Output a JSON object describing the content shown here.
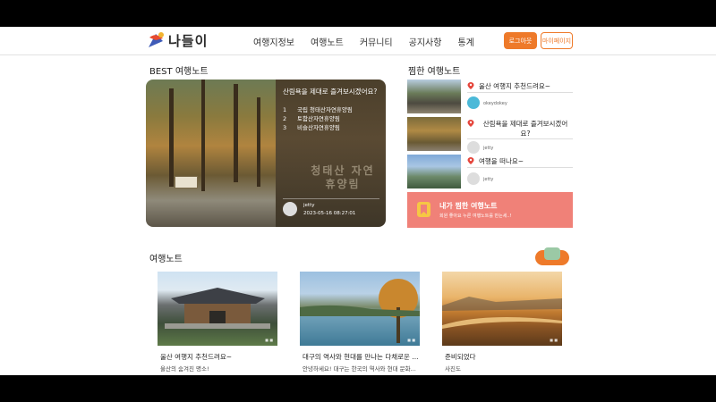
{
  "header": {
    "logo_text": "나들이",
    "nav": [
      "여행지정보",
      "여행노트",
      "커뮤니티",
      "공지사항",
      "통계"
    ],
    "login_label": "로그아웃",
    "mypage_label": "마이페이지"
  },
  "best": {
    "section_title": "BEST 여행노트",
    "title": "산림욕을 제대로 즐겨보시겠어요?",
    "list": [
      {
        "num": "1",
        "name": "국립 청태산자연휴양림"
      },
      {
        "num": "2",
        "name": "토함산자연휴양림"
      },
      {
        "num": "3",
        "name": "비슬산자연휴양림"
      }
    ],
    "photo_text": "청태산 자연휴양림",
    "user": "jetty",
    "date": "2023-05-16 08:27:01"
  },
  "bookmarks": {
    "section_title": "찜한 여행노트",
    "items": [
      {
        "title": "울산 여행지 추천드려요~",
        "user": "okeydokey"
      },
      {
        "title": "산림욕을 제대로 즐겨보시겠어요?",
        "user": "jetty"
      },
      {
        "title": "여행을 떠나요~",
        "user": "jetty"
      }
    ],
    "cta_title": "내가 찜한 여행노트",
    "cta_sub": "회원 좋아요 누른 여행노트를 만는세..!"
  },
  "notes": {
    "section_title": "여행노트",
    "cards": [
      {
        "title": "울산 여행지 추천드려요~",
        "desc": "울산의 숨겨진 명소!"
      },
      {
        "title": "대구의 역사와 현대를 만나는 다채로운 ...",
        "desc": "안녕하세요! 대구는 한국의 역사와 현대 문화..."
      },
      {
        "title": "준비되었다",
        "desc": "사진도"
      }
    ]
  },
  "colors": {
    "accent": "#ee7a2a",
    "cta": "#f08178"
  }
}
